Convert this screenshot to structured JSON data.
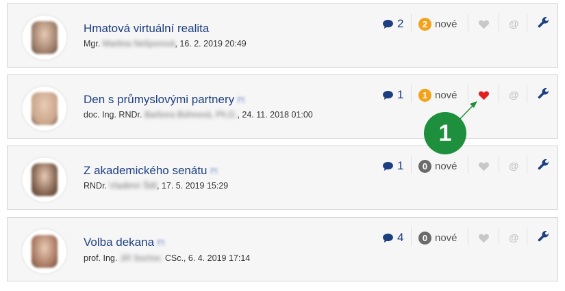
{
  "posts": [
    {
      "title": "Hmatová virtuální realita",
      "author_prefix": "Mgr.",
      "author_name": "Martina Nešporová",
      "author_suffix": ",",
      "date": "16. 2. 2019 20:49",
      "comments": "2",
      "new_count": "2",
      "new_label": "nové",
      "has_tag": false,
      "liked": false,
      "badge_color": "#f2a31b",
      "avatar_tone": "#9a7a66"
    },
    {
      "title": "Den s průmyslovými partnery",
      "author_prefix": "doc. Ing. RNDr.",
      "author_name": "Barbora Bühnová, Ph.D.",
      "author_suffix": ",",
      "date": "24. 11. 2018 01:00",
      "comments": "1",
      "new_count": "1",
      "new_label": "nové",
      "has_tag": true,
      "liked": true,
      "badge_color": "#f2a31b",
      "avatar_tone": "#c9a48a"
    },
    {
      "title": "Z akademického senátu",
      "author_prefix": "RNDr.",
      "author_name": "Vladimír Štill",
      "author_suffix": ",",
      "date": "17. 5. 2019 15:29",
      "comments": "1",
      "new_count": "0",
      "new_label": "nové",
      "has_tag": true,
      "liked": false,
      "badge_color": "#6b6b6b",
      "avatar_tone": "#7a5a48"
    },
    {
      "title": "Volba dekana",
      "author_prefix": "prof. Ing.",
      "author_name": "Jiří Sochor,",
      "author_suffix": " CSc.,",
      "date": "6. 4. 2019 17:14",
      "comments": "4",
      "new_count": "0",
      "new_label": "nové",
      "has_tag": true,
      "liked": false,
      "badge_color": "#6b6b6b",
      "avatar_tone": "#a5735c"
    }
  ],
  "colors": {
    "link": "#1d3f80",
    "heart_active": "#e02020",
    "heart_inactive": "#c8c8c8",
    "marker": "#1e8f3c"
  },
  "annotation": {
    "label": "1"
  },
  "icons": {
    "comment": "speech-bubble-icon",
    "heart": "heart-icon",
    "mention": "at-sign-icon",
    "settings": "wrench-icon"
  }
}
